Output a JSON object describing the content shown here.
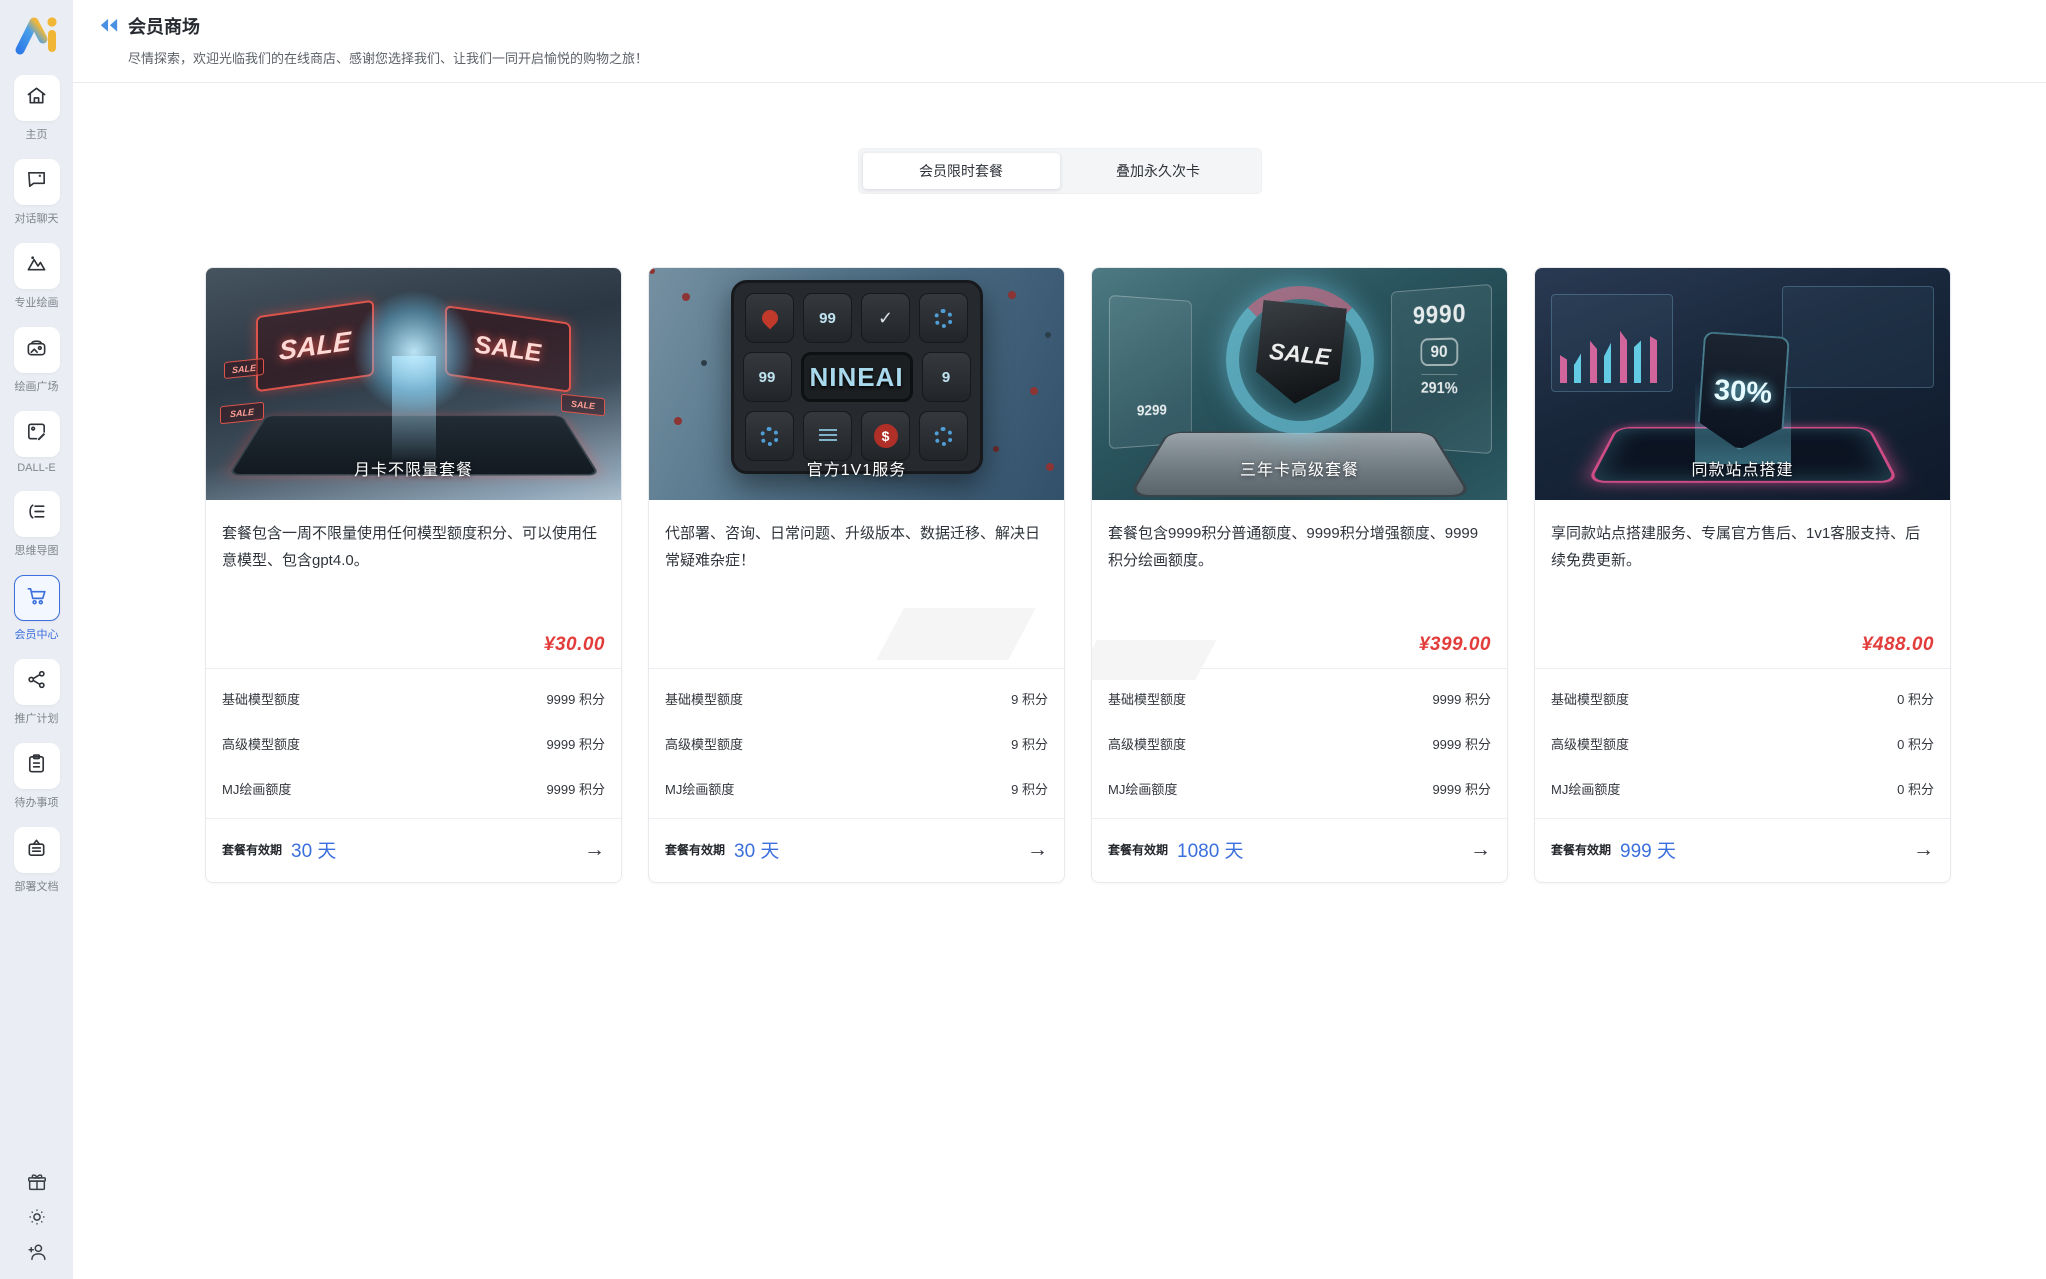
{
  "header": {
    "title": "会员商场",
    "subtitle": "尽情探索，欢迎光临我们的在线商店、感谢您选择我们、让我们一同开启愉悦的购物之旅！"
  },
  "sidebar": {
    "items": [
      {
        "label": "主页"
      },
      {
        "label": "对话聊天"
      },
      {
        "label": "专业绘画"
      },
      {
        "label": "绘画广场"
      },
      {
        "label": "DALL-E"
      },
      {
        "label": "思维导图"
      },
      {
        "label": "会员中心",
        "active": true
      },
      {
        "label": "推广计划"
      },
      {
        "label": "待办事项"
      },
      {
        "label": "部署文档"
      }
    ]
  },
  "tabs": [
    {
      "label": "会员限时套餐",
      "active": true
    },
    {
      "label": "叠加永久次卡",
      "active": false
    }
  ],
  "icons": {
    "arrow_right": "→"
  },
  "colors": {
    "accent_blue": "#3a6fdd",
    "price_red": "#e23d3b",
    "sidebar_bg": "#eaedf3"
  },
  "cards": [
    {
      "image": {
        "title": "月卡不限量套餐",
        "badge": "SALE"
      },
      "description": "套餐包含一周不限量使用任何模型额度积分、可以使用任意模型、包含gpt4.0。",
      "price": "¥30.00",
      "rows": [
        {
          "label": "基础模型额度",
          "value": "9999 积分"
        },
        {
          "label": "高级模型额度",
          "value": "9999 积分"
        },
        {
          "label": "MJ绘画额度",
          "value": "9999 积分"
        }
      ],
      "validity_label": "套餐有效期",
      "validity_value": "30 天"
    },
    {
      "image": {
        "title": "官方1V1服务",
        "brand": "NINEAI",
        "key_99": "99",
        "key_9": "9",
        "key_dollar": "$",
        "key_check": "✓"
      },
      "description": "代部署、咨询、日常问题、升级版本、数据迁移、解决日常疑难杂症！",
      "price": "",
      "rows": [
        {
          "label": "基础模型额度",
          "value": "9 积分"
        },
        {
          "label": "高级模型额度",
          "value": "9 积分"
        },
        {
          "label": "MJ绘画额度",
          "value": "9 积分"
        }
      ],
      "validity_label": "套餐有效期",
      "validity_value": "30 天"
    },
    {
      "image": {
        "title": "三年卡高级套餐",
        "shield": "SALE",
        "hud": [
          "9299",
          "9990",
          "90",
          "291%"
        ]
      },
      "description": "套餐包含9999积分普通额度、9999积分增强额度、9999积分绘画额度。",
      "price": "¥399.00",
      "rows": [
        {
          "label": "基础模型额度",
          "value": "9999 积分"
        },
        {
          "label": "高级模型额度",
          "value": "9999 积分"
        },
        {
          "label": "MJ绘画额度",
          "value": "9999 积分"
        }
      ],
      "validity_label": "套餐有效期",
      "validity_value": "1080 天"
    },
    {
      "image": {
        "title": "同款站点搭建",
        "tag": "30%"
      },
      "description": "享同款站点搭建服务、专属官方售后、1v1客服支持、后续免费更新。",
      "price": "¥488.00",
      "rows": [
        {
          "label": "基础模型额度",
          "value": "0 积分"
        },
        {
          "label": "高级模型额度",
          "value": "0 积分"
        },
        {
          "label": "MJ绘画额度",
          "value": "0 积分"
        }
      ],
      "validity_label": "套餐有效期",
      "validity_value": "999 天"
    }
  ]
}
